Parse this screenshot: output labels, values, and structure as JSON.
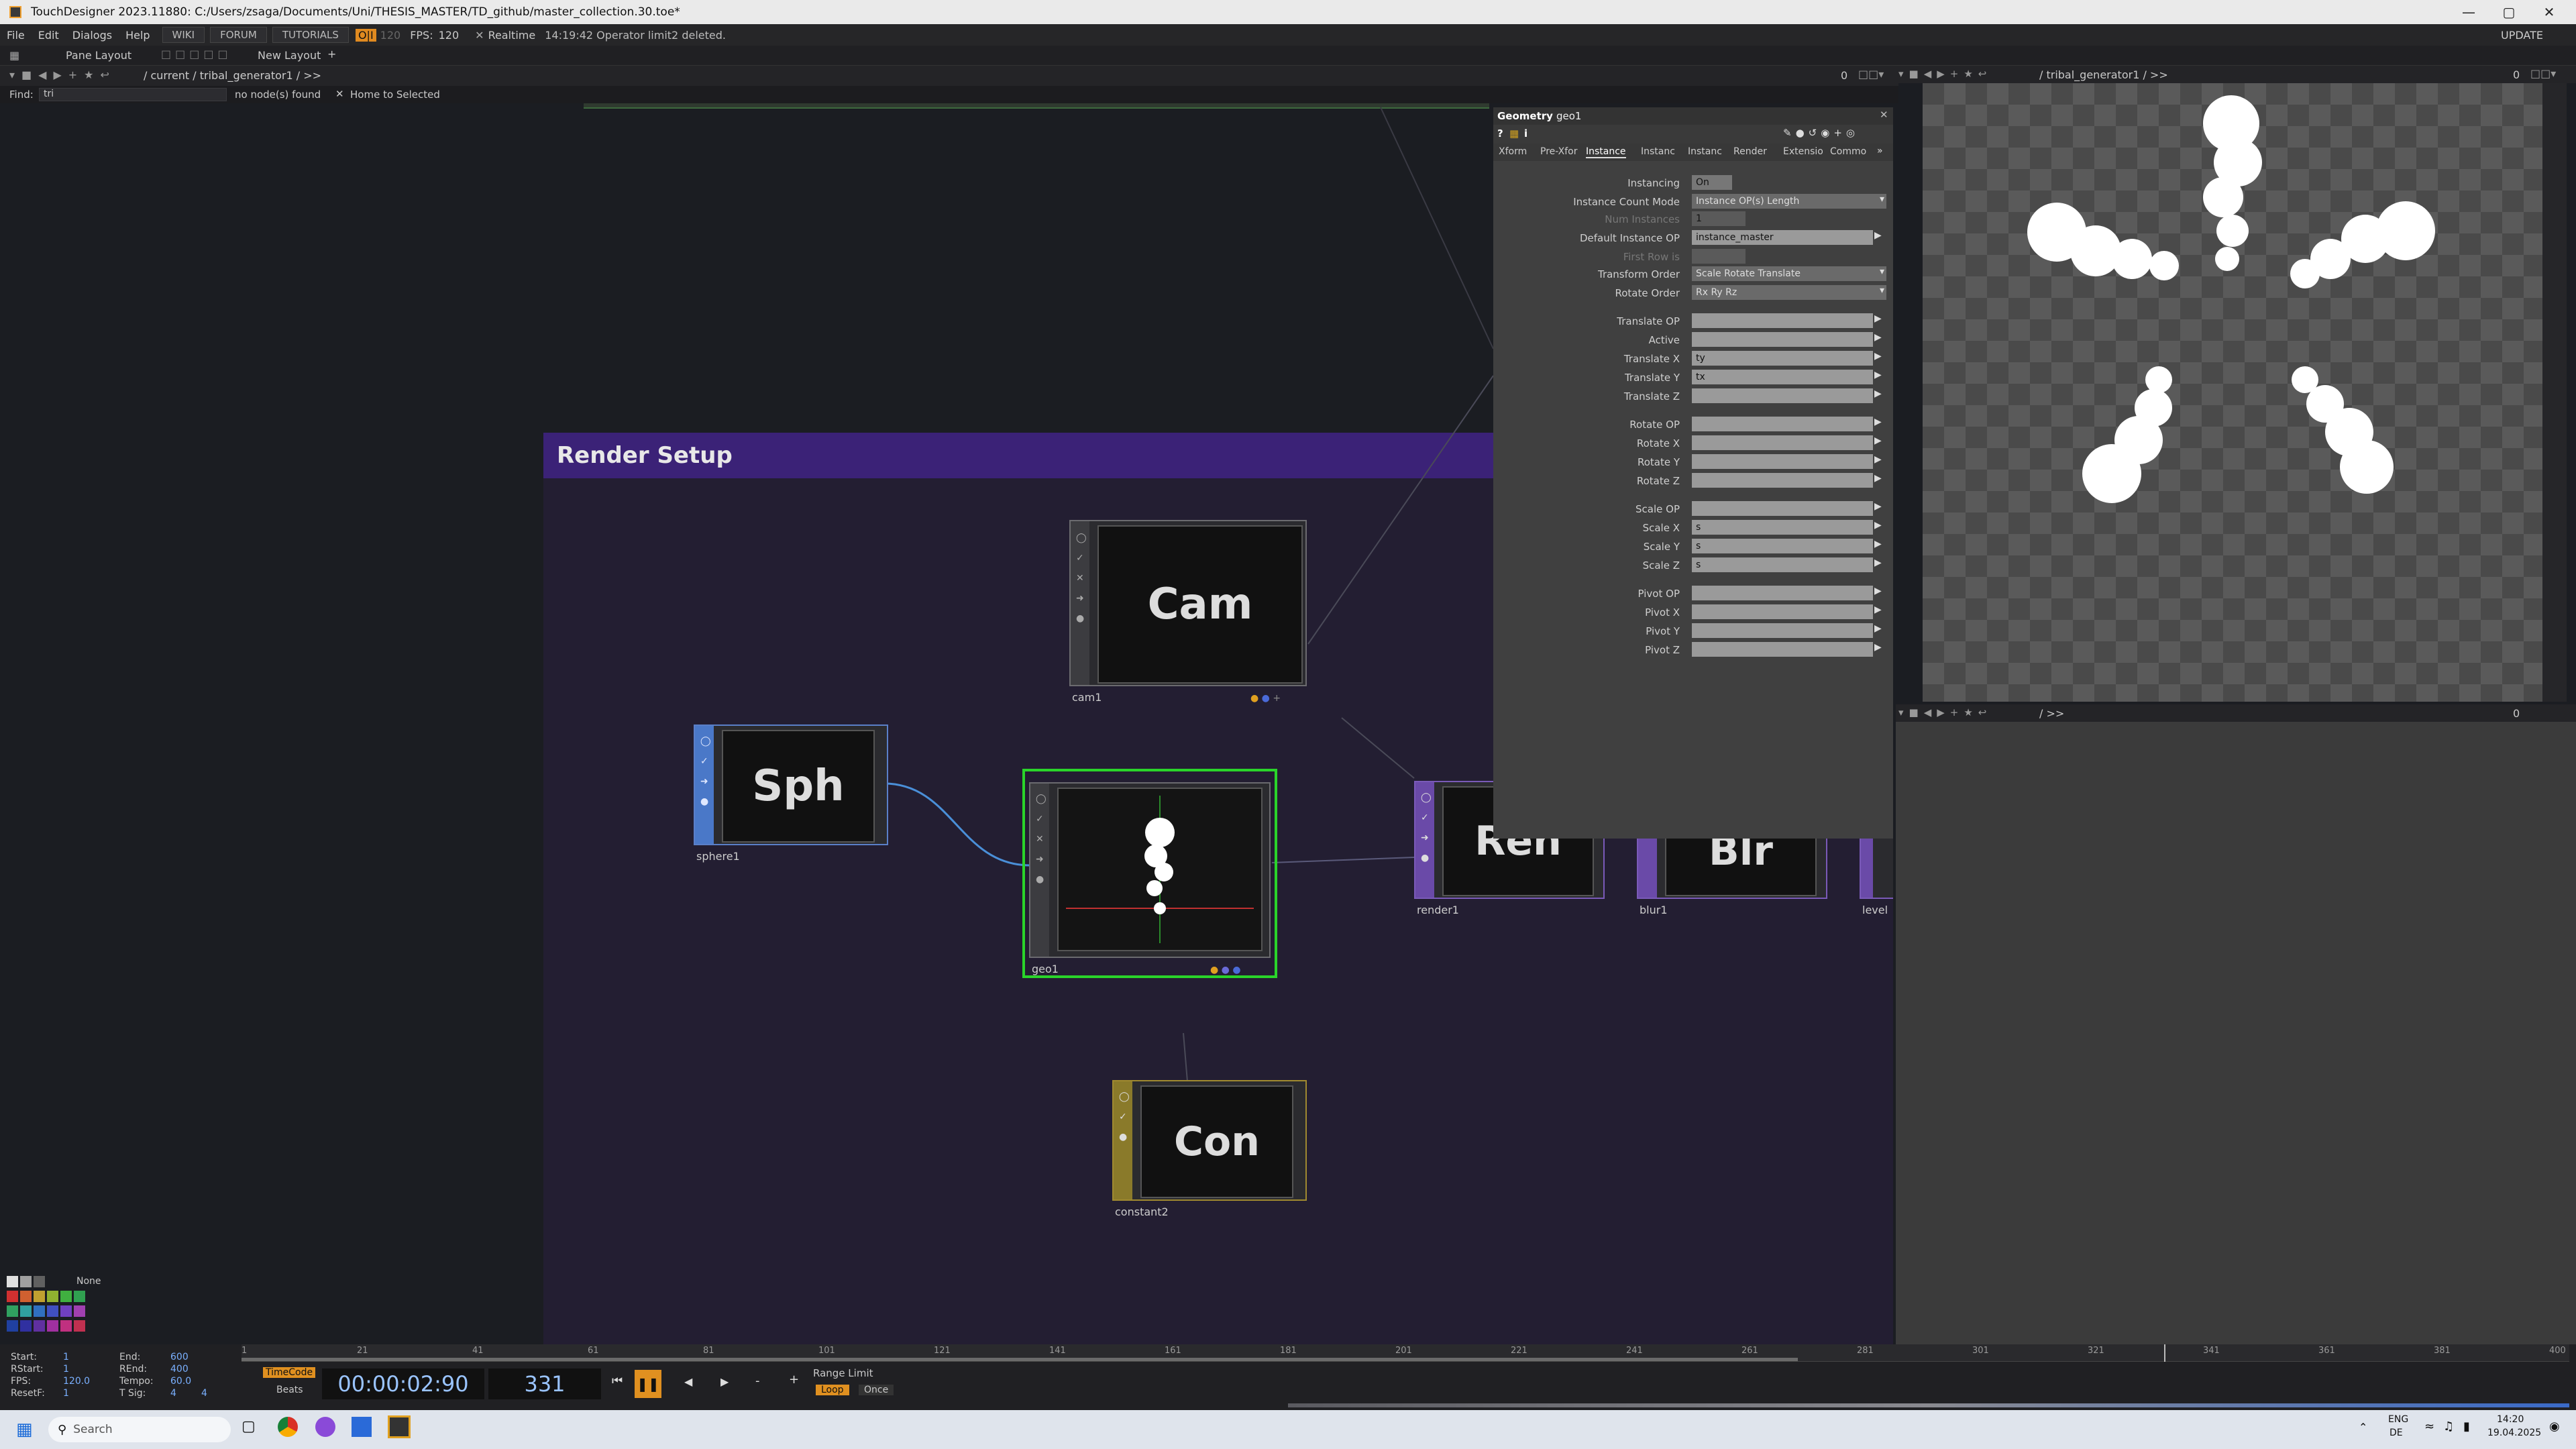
{
  "window": {
    "title": "TouchDesigner 2023.11880: C:/Users/zsaga/Documents/Uni/THESIS_MASTER/TD_github/master_collection.30.toe*",
    "update": "UPDATE"
  },
  "menu": {
    "items": [
      "File",
      "Edit",
      "Dialogs",
      "Help"
    ],
    "buttons": [
      "WIKI",
      "FORUM",
      "TUTORIALS"
    ],
    "oi": "O|I",
    "fps_dim": "120",
    "fps_label": "FPS:",
    "fps_value": "120",
    "realtime": "Realtime",
    "status": "14:19:42 Operator limit2 deleted."
  },
  "layout": {
    "pane": "Pane Layout",
    "new": "New Layout"
  },
  "pathbar": {
    "left": "/ current / tribal_generator1 / >>",
    "right": "/ tribal_generator1 / >>",
    "bottom": "/ >>",
    "zero": "0"
  },
  "find": {
    "label": "Find:",
    "value": "tri",
    "none": "no node(s) found",
    "home": "Home to Selected"
  },
  "network": {
    "annotation": "Render Setup"
  },
  "nodes": {
    "cam": {
      "view": "Cam",
      "label": "cam1"
    },
    "sph": {
      "view": "Sph",
      "label": "sphere1"
    },
    "geo": {
      "label": "geo1"
    },
    "con": {
      "view": "Con",
      "label": "constant2"
    },
    "ren": {
      "view": "Ren",
      "label": "render1"
    },
    "blr": {
      "view": "Blr",
      "label": "blur1"
    },
    "lev": {
      "label": "level"
    }
  },
  "params": {
    "type": "Geometry",
    "name": "geo1",
    "tabs": [
      "Xform",
      "Pre-Xfor",
      "Instance",
      "Instanc",
      "Instanc",
      "Render",
      "Extensio",
      "Commo"
    ],
    "active_tab": "Instance",
    "rows": [
      {
        "label": "Instancing",
        "value": "On",
        "kind": "toggle"
      },
      {
        "label": "Instance Count Mode",
        "value": "Instance OP(s) Length",
        "kind": "menu"
      },
      {
        "label": "Num Instances",
        "value": "1",
        "kind": "dim"
      },
      {
        "label": "Default Instance OP",
        "value": "instance_master",
        "kind": "field"
      },
      {
        "label": "First Row is",
        "value": "",
        "kind": "dim"
      },
      {
        "label": "Transform Order",
        "value": "Scale Rotate Translate",
        "kind": "menu"
      },
      {
        "label": "Rotate Order",
        "value": "Rx Ry Rz",
        "kind": "menu"
      },
      {
        "label": "Translate OP",
        "value": "",
        "kind": "field"
      },
      {
        "label": "Active",
        "value": "",
        "kind": "field"
      },
      {
        "label": "Translate X",
        "value": "ty",
        "kind": "field"
      },
      {
        "label": "Translate Y",
        "value": "tx",
        "kind": "field"
      },
      {
        "label": "Translate Z",
        "value": "",
        "kind": "field"
      },
      {
        "label": "Rotate OP",
        "value": "",
        "kind": "field"
      },
      {
        "label": "Rotate X",
        "value": "",
        "kind": "field"
      },
      {
        "label": "Rotate Y",
        "value": "",
        "kind": "field"
      },
      {
        "label": "Rotate Z",
        "value": "",
        "kind": "field"
      },
      {
        "label": "Scale OP",
        "value": "",
        "kind": "field"
      },
      {
        "label": "Scale X",
        "value": "s",
        "kind": "field"
      },
      {
        "label": "Scale Y",
        "value": "s",
        "kind": "field"
      },
      {
        "label": "Scale Z",
        "value": "s",
        "kind": "field"
      },
      {
        "label": "Pivot OP",
        "value": "",
        "kind": "field"
      },
      {
        "label": "Pivot X",
        "value": "",
        "kind": "field"
      },
      {
        "label": "Pivot Y",
        "value": "",
        "kind": "field"
      },
      {
        "label": "Pivot Z",
        "value": "",
        "kind": "field"
      }
    ]
  },
  "palette": {
    "none": "None"
  },
  "range": {
    "start_l": "Start:",
    "start": "1",
    "end_l": "End:",
    "end": "600",
    "rstart_l": "RStart:",
    "rstart": "1",
    "rend_l": "REnd:",
    "rend": "400",
    "fps_l": "FPS:",
    "fps": "120.0",
    "tempo_l": "Tempo:",
    "tempo": "60.0",
    "resetf_l": "ResetF:",
    "resetf": "1",
    "tsig_l": "T Sig:",
    "tsig1": "4",
    "tsig2": "4"
  },
  "timeline": {
    "ticks": [
      "1",
      "21",
      "41",
      "61",
      "81",
      "101",
      "121",
      "141",
      "161",
      "181",
      "201",
      "221",
      "241",
      "261",
      "281",
      "301",
      "321",
      "341",
      "361",
      "381",
      "400"
    ],
    "timecode_btn": "TimeCode",
    "beats_btn": "Beats",
    "timecode": "00:00:02:90",
    "frame": "331",
    "range_limit": "Range Limit",
    "loop": "Loop",
    "once": "Once"
  },
  "taskbar": {
    "search": "Search",
    "lang1": "ENG",
    "lang2": "DE",
    "time": "14:20",
    "date": "19.04.2025"
  }
}
